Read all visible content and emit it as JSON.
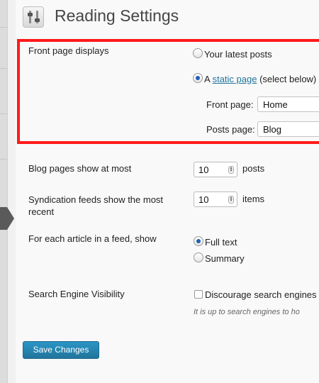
{
  "page_title": "Reading Settings",
  "front_page": {
    "label": "Front page displays",
    "options": [
      {
        "label": "Your latest posts",
        "selected": false
      },
      {
        "label_prefix": "A ",
        "link": "static page",
        "label_suffix": " (select below)",
        "selected": true
      }
    ],
    "front_page_label": "Front page:",
    "front_page_value": "Home",
    "posts_page_label": "Posts page:",
    "posts_page_value": "Blog"
  },
  "blog_pages": {
    "label": "Blog pages show at most",
    "value": "10",
    "unit": "posts"
  },
  "syndication": {
    "label": "Syndication feeds show the most recent",
    "value": "10",
    "unit": "items"
  },
  "feed_article": {
    "label": "For each article in a feed, show",
    "options": [
      {
        "label": "Full text",
        "selected": true
      },
      {
        "label": "Summary",
        "selected": false
      }
    ]
  },
  "search_visibility": {
    "label": "Search Engine Visibility",
    "checkbox_label": "Discourage search engines",
    "checked": false,
    "hint": "It is up to search engines to ho"
  },
  "save_button": "Save Changes",
  "colors": {
    "highlight": "#ff1a1a",
    "accent": "#21759b",
    "radio_dot": "#1f5fb6"
  }
}
